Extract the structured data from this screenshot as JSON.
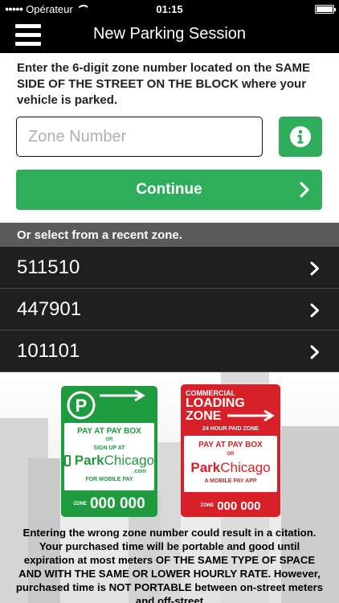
{
  "status_bar": {
    "carrier": "Opérateur",
    "time": "01:15"
  },
  "nav": {
    "title": "New Parking Session"
  },
  "instructions": "Enter the 6-digit zone number located on the SAME SIDE OF THE STREET ON THE BLOCK where your vehicle is parked.",
  "zone_input": {
    "placeholder": "Zone Number",
    "value": ""
  },
  "continue_label": "Continue",
  "recent_header": "Or select from a recent zone.",
  "recent_zones": [
    "511510",
    "447901",
    "101101"
  ],
  "signs": {
    "green": {
      "line1": "PAY AT PAY BOX",
      "or": "OR",
      "signup": "SIGN UP AT",
      "brand_park": "Park",
      "brand_chicago": "Chicago",
      "com": ".com",
      "mobile": "FOR MOBILE PAY",
      "zone_label": "ZONE",
      "zone_number": "000 000"
    },
    "red": {
      "commercial": "COMMERCIAL",
      "loading": "LOADING",
      "zone": "ZONE",
      "hours": "24 HOUR PAID ZONE",
      "line1": "PAY AT PAY BOX",
      "or": "OR",
      "brand_park": "Park",
      "brand_chicago": "Chicago",
      "app": "A MOBILE PAY APP",
      "zone_label": "ZONE",
      "zone_number": "000 000"
    }
  },
  "disclaimer": "Entering the wrong zone number could result in a citation. Your purchased time will be portable and good until expiration at most meters OF THE SAME TYPE OF SPACE AND WITH THE SAME OR LOWER HOURLY RATE.  However, purchased time is NOT PORTABLE between on-street meters and off-street",
  "colors": {
    "accent_green": "#2ead5a",
    "sign_green": "#1e9a3f",
    "sign_red": "#d72027",
    "row_dark": "#1f1f1f",
    "header_gray": "#5a5a5a"
  },
  "icons": [
    "hamburger-menu-icon",
    "info-icon",
    "chevron-right-icon",
    "wifi-icon",
    "battery-icon",
    "parking-p-icon",
    "arrow-right-icon",
    "phone-icon"
  ]
}
